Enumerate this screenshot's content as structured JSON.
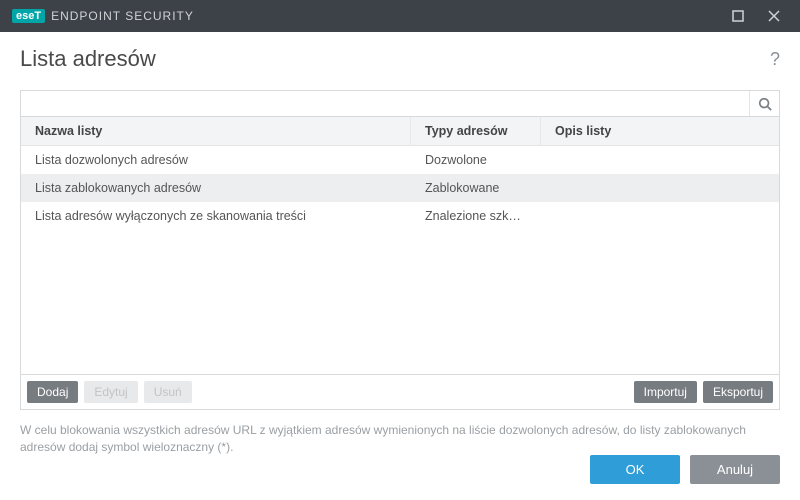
{
  "brand": {
    "badge": "eseT",
    "product": "ENDPOINT SECURITY"
  },
  "page": {
    "title": "Lista adresów"
  },
  "search": {
    "value": "",
    "placeholder": ""
  },
  "columns": {
    "name": "Nazwa listy",
    "type": "Typy adresów",
    "desc": "Opis listy"
  },
  "rows": [
    {
      "name": "Lista dozwolonych adresów",
      "type": "Dozwolone",
      "desc": "",
      "selected": false
    },
    {
      "name": "Lista zablokowanych adresów",
      "type": "Zablokowane",
      "desc": "",
      "selected": true
    },
    {
      "name": "Lista adresów wyłączonych ze skanowania treści",
      "type": "Znalezione szkodliwe opr...",
      "desc": "",
      "selected": false
    }
  ],
  "actions": {
    "add": "Dodaj",
    "edit": "Edytuj",
    "delete": "Usuń",
    "import": "Importuj",
    "export": "Eksportuj"
  },
  "hint": "W celu blokowania wszystkich adresów URL z wyjątkiem adresów wymienionych na liście dozwolonych adresów, do listy zablokowanych adresów dodaj symbol wieloznaczny (*).",
  "footer": {
    "ok": "OK",
    "cancel": "Anuluj"
  }
}
